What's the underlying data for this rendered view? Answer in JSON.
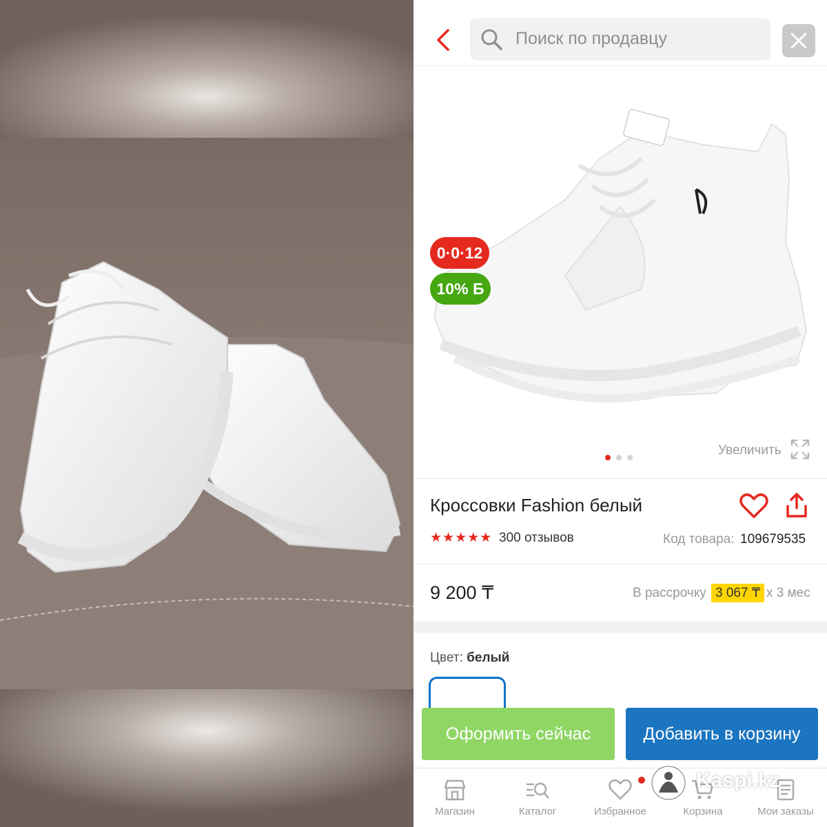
{
  "search": {
    "placeholder": "Поиск по продавцу"
  },
  "product": {
    "badge_installment": "0·0·12",
    "badge_bonus": "10% Б",
    "zoom_label": "Увеличить",
    "title": "Кроссовки Fashion белый",
    "rating_stars": 5,
    "reviews": "300 отзывов",
    "sku_label": "Код товара:",
    "sku_value": "109679535",
    "price": "9 200 ₸",
    "installment_label": "В рассрочку",
    "installment_amount": "3 067 ₸",
    "installment_term": "x 3 мес",
    "color_label": "Цвет:",
    "color_value": "белый",
    "image_count": 3,
    "active_image": 1
  },
  "actions": {
    "checkout": "Оформить сейчас",
    "add_to_cart": "Добавить в корзину"
  },
  "nav": [
    {
      "label": "Магазин",
      "icon": "shop-icon"
    },
    {
      "label": "Каталог",
      "icon": "catalog-icon"
    },
    {
      "label": "Избранное",
      "icon": "heart-icon"
    },
    {
      "label": "Корзина",
      "icon": "cart-icon"
    },
    {
      "label": "Мои заказы",
      "icon": "orders-icon"
    }
  ],
  "watermark": {
    "text": "Kaspi.kz"
  },
  "colors": {
    "accent_red": "#e5291f",
    "bonus_green": "#46a711",
    "checkout_green": "#8fd664",
    "cart_blue": "#1b75c0",
    "installment_yellow": "#ffd600"
  }
}
